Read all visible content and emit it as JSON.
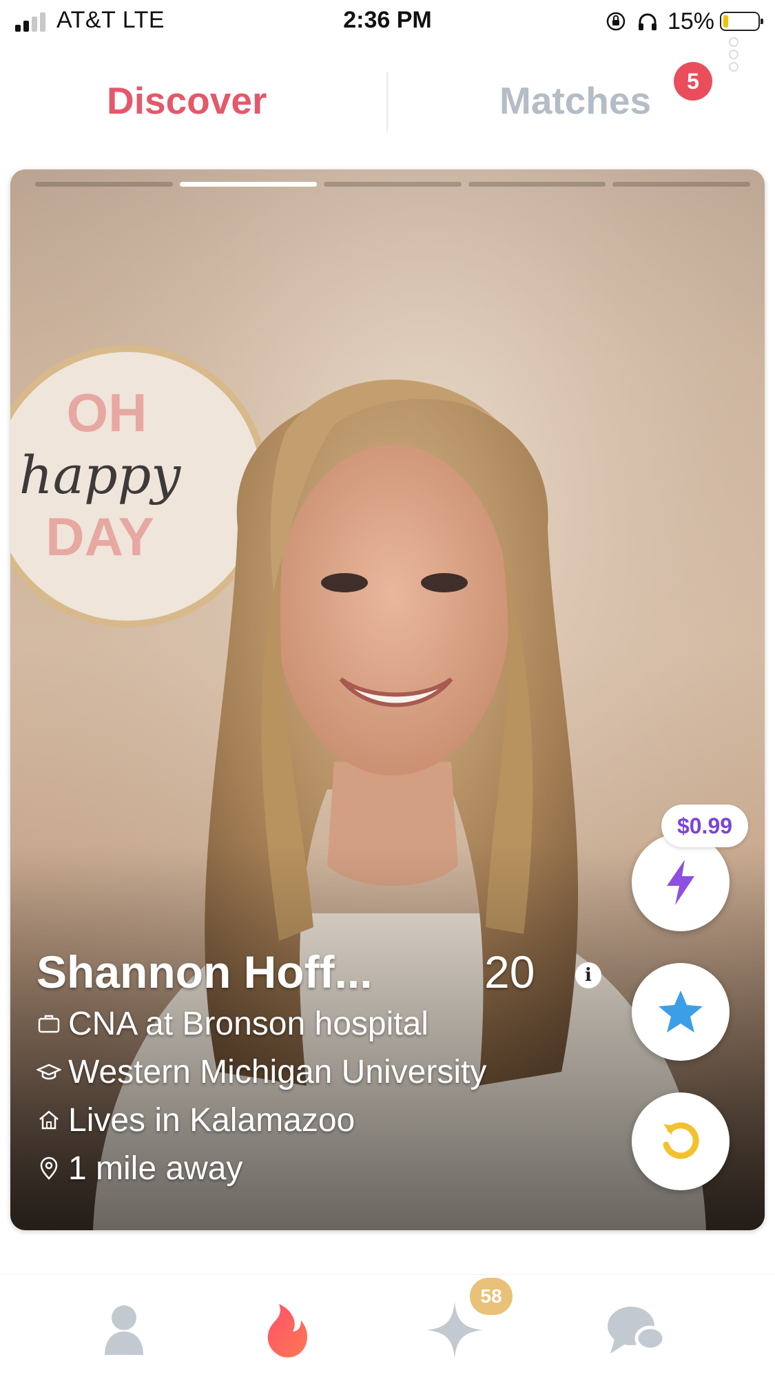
{
  "status_bar": {
    "carrier": "AT&T  LTE",
    "time": "2:36 PM",
    "battery_percent": "15%",
    "battery_level": 0.15,
    "icons": [
      "signal-icon",
      "orientation-lock-icon",
      "headphones-icon",
      "battery-icon"
    ]
  },
  "tabs": {
    "discover": "Discover",
    "matches": "Matches",
    "matches_badge": "5",
    "active": "discover"
  },
  "card": {
    "photo_count": 5,
    "active_photo_index": 1,
    "photo_sign": {
      "line1": "OH",
      "line2": "happy",
      "line3": "DAY"
    },
    "name": "Shannon Hoff...",
    "age": "20",
    "info_icon": "i",
    "details": [
      {
        "icon": "briefcase-icon",
        "text": "CNA at Bronson hospital"
      },
      {
        "icon": "graduation-cap-icon",
        "text": "Western Michigan University"
      },
      {
        "icon": "home-icon",
        "text": "Lives in Kalamazoo"
      },
      {
        "icon": "location-pin-icon",
        "text": "1 mile away"
      }
    ]
  },
  "actions": {
    "boost_price": "$0.99",
    "buttons": [
      "boost-bolt-icon",
      "super-like-star-icon",
      "rewind-icon"
    ]
  },
  "bottom_nav": {
    "items": [
      "profile-icon",
      "tinder-flame-icon",
      "top-picks-sparkle-icon",
      "messages-icon"
    ],
    "top_picks_badge": "58",
    "active": "tinder-flame-icon"
  },
  "colors": {
    "accent": "#e4586a",
    "inactive_tab": "#b4bcc6",
    "badge_red": "#ea4d5c",
    "boost_purple": "#7b45d6",
    "star_blue": "#3d9ee8",
    "rewind_yellow": "#f2c12e",
    "top_picks_gold": "#e9c179"
  }
}
